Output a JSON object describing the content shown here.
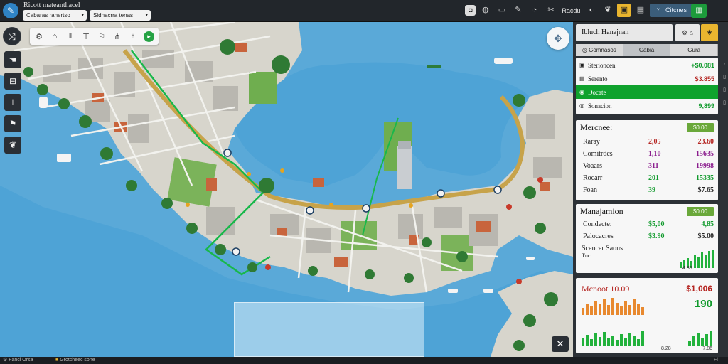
{
  "window": {
    "title": "Ricott mateanthacel",
    "dropdown_1": "Cabaras ranertso",
    "dropdown_2": "Sidnacrra tenas"
  },
  "toolbar": {
    "label": "Racdu",
    "button": "Citcnes",
    "icons": [
      "camera-icon",
      "globe-icon",
      "monitor-icon",
      "pencil-icon",
      "chat-icon",
      "tools-icon",
      "half-circle-icon",
      "leaf-icon",
      "gold-badge-icon",
      "document-icon"
    ]
  },
  "left_rail": [
    "route-icon",
    "hand-icon",
    "bus-icon",
    "crane-icon",
    "flag-icon",
    "leaf-icon"
  ],
  "map_tools": [
    "bulldozer-icon",
    "building-icon",
    "pause-icon",
    "crane-icon",
    "flag-icon",
    "signal-icon",
    "lamp-icon",
    "green-dot-icon"
  ],
  "panel": {
    "title": "Ibluch Hanajnan",
    "tabs": [
      "Gomnasos",
      "Gabia",
      "Gura"
    ],
    "list": [
      {
        "name": "Sterioncen",
        "value": "+$0.081",
        "color": "green"
      },
      {
        "name": "Serento",
        "value": "$3.855",
        "color": "red"
      },
      {
        "name": "Docate",
        "value": "",
        "color": "white",
        "selected": true
      },
      {
        "name": "Sonacion",
        "value": "9,899",
        "color": "green"
      }
    ],
    "stats": {
      "title": "Mercnee:",
      "badge": "$0.00",
      "rows": [
        {
          "label": "Raray",
          "a": "2,05",
          "b": "23.60",
          "ac": "red",
          "bc": "red"
        },
        {
          "label": "Comitrdcs",
          "a": "1,10",
          "b": "15635",
          "ac": "purple",
          "bc": "purple"
        },
        {
          "label": "Voaars",
          "a": "311",
          "b": "19998",
          "ac": "purple",
          "bc": "purple"
        },
        {
          "label": "Rocarr",
          "a": "201",
          "b": "15335",
          "ac": "green",
          "bc": "green"
        },
        {
          "label": "Foan",
          "a": "39",
          "b": "$7.65",
          "ac": "green",
          "bc": "dark"
        }
      ]
    },
    "management": {
      "title": "Manajamion",
      "badge": "$0.00",
      "rows": [
        {
          "label": "Condecte:",
          "a": "$5,00",
          "b": "4,85",
          "ac": "green",
          "bc": "green"
        },
        {
          "label": "Palocacres",
          "a": "$3.90",
          "b": "$5.00",
          "ac": "green",
          "bc": "dark"
        }
      ],
      "chart_label": "Scencer Saons",
      "chart_sub": "Tnc",
      "chart_axis": "4.86"
    },
    "budget": {
      "title": "Mcnoot 10.09",
      "value": "$1,006",
      "figure": "190",
      "foot_left": "8,28",
      "foot_right": "7,86"
    }
  },
  "bottom": {
    "left_label": "Fancl Orsa",
    "mid_label": "Grotcheec sone",
    "right_label": "Fl"
  }
}
